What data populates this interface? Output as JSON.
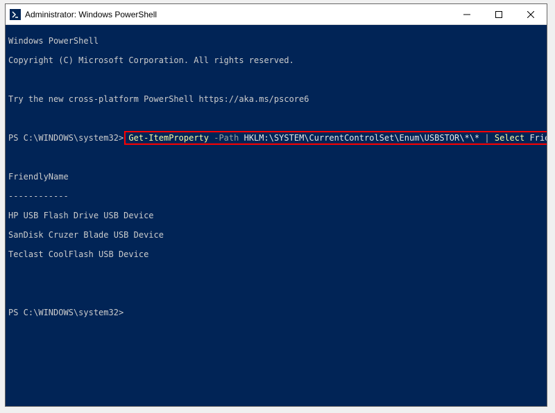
{
  "window": {
    "title": "Administrator: Windows PowerShell"
  },
  "terminal": {
    "banner_line1": "Windows PowerShell",
    "banner_line2": "Copyright (C) Microsoft Corporation. All rights reserved.",
    "try_line": "Try the new cross-platform PowerShell https://aka.ms/pscore6",
    "prompt": "PS C:\\WINDOWS\\system32>",
    "command": {
      "cmdlet1": "Get-ItemProperty",
      "param1": "-Path",
      "path": "HKLM:\\SYSTEM\\CurrentControlSet\\Enum\\USBSTOR\\*\\*",
      "pipe": "|",
      "cmdlet2": "Select",
      "prop": "FriendlyName"
    },
    "output": {
      "header": "FriendlyName",
      "rule": "------------",
      "rows": [
        "HP USB Flash Drive USB Device",
        "SanDisk Cruzer Blade USB Device",
        "Teclast CoolFlash USB Device"
      ]
    }
  }
}
